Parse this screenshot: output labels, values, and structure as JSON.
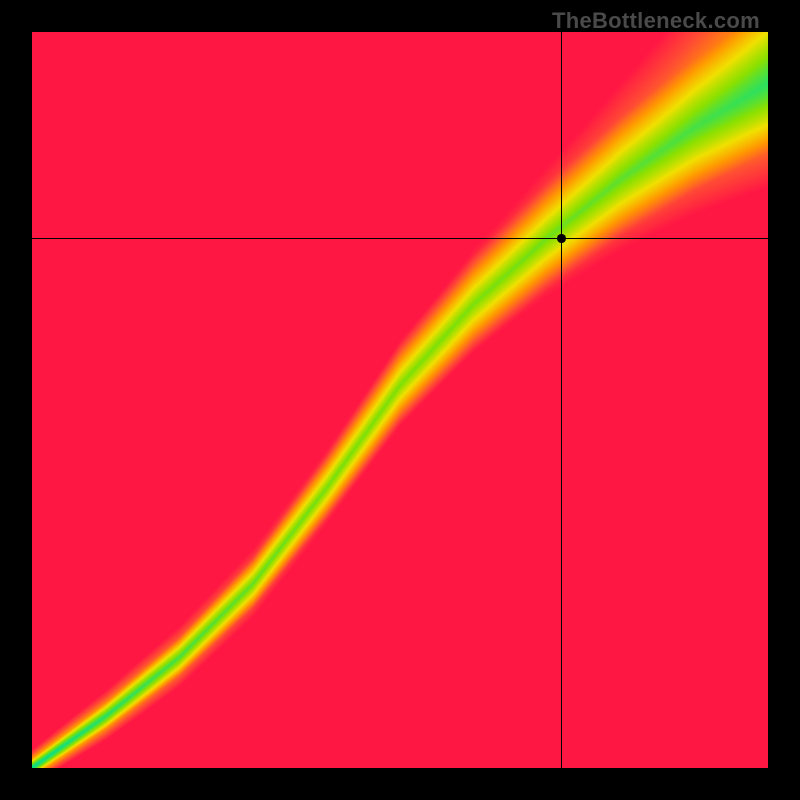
{
  "watermark": "TheBottleneck.com",
  "chart_data": {
    "type": "heatmap",
    "title": "",
    "xlabel": "",
    "ylabel": "",
    "x_range": [
      0,
      1
    ],
    "y_range": [
      0,
      1
    ],
    "marker": {
      "x": 0.72,
      "y": 0.72
    },
    "crosshair": {
      "x": 0.72,
      "y": 0.72
    },
    "ideal_curve": {
      "description": "Green optimal band following a slightly S-shaped diagonal from bottom-left to top-right",
      "points": [
        {
          "x": 0.0,
          "y": 0.0
        },
        {
          "x": 0.1,
          "y": 0.07
        },
        {
          "x": 0.2,
          "y": 0.15
        },
        {
          "x": 0.3,
          "y": 0.25
        },
        {
          "x": 0.4,
          "y": 0.38
        },
        {
          "x": 0.5,
          "y": 0.52
        },
        {
          "x": 0.6,
          "y": 0.63
        },
        {
          "x": 0.7,
          "y": 0.72
        },
        {
          "x": 0.8,
          "y": 0.8
        },
        {
          "x": 0.9,
          "y": 0.87
        },
        {
          "x": 1.0,
          "y": 0.93
        }
      ],
      "band_width_start": 0.01,
      "band_width_end": 0.1
    },
    "color_scale": {
      "stops": [
        {
          "t": 0.0,
          "color": "#00e08a"
        },
        {
          "t": 0.18,
          "color": "#8be000"
        },
        {
          "t": 0.35,
          "color": "#f0e000"
        },
        {
          "t": 0.55,
          "color": "#ff9900"
        },
        {
          "t": 0.78,
          "color": "#ff4d33"
        },
        {
          "t": 1.0,
          "color": "#ff1744"
        }
      ]
    },
    "corner_bias": {
      "top_left": 1.0,
      "bottom_right": 1.0,
      "top_right": 0.55,
      "bottom_left": 0.0
    }
  }
}
